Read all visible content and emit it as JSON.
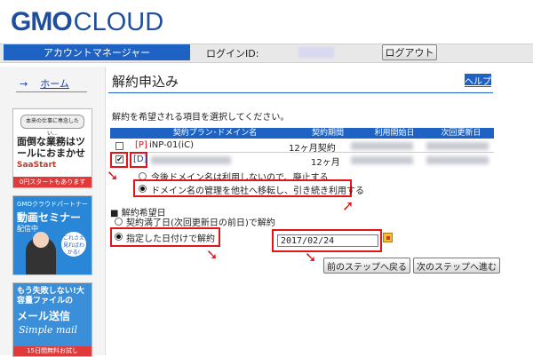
{
  "header": {
    "logo_gmo": "GMO",
    "logo_cloud": "CLOUD",
    "account_manager": "アカウントマネージャー",
    "login_label": "ログインID:",
    "logout": "ログアウト"
  },
  "sidebar": {
    "home_arrow": "→",
    "home_label": "ホーム",
    "ad1": {
      "tagline": "本来の仕事に専念したい…",
      "headline": "面倒な業務はツールにおまかせ",
      "brand": "SaaStart",
      "banner": "0円スタートもあります"
    },
    "ad2": {
      "tagline": "GMOクラウドパートナー",
      "headline": "動画セミナー",
      "sub": "配信中",
      "bubble": "これさえ見ればわかる!"
    },
    "ad3": {
      "tagline": "もう失敗しない!大容量ファイルの",
      "headline": "メール送信",
      "brand": "Simple mail",
      "banner": "15日間無料お試し"
    }
  },
  "main": {
    "title": "解約申込み",
    "help": "ヘルプ",
    "instruction": "解約を希望される項目を選択してください。",
    "table": {
      "headers": [
        "契約プラン･ドメイン名",
        "契約期間",
        "利用開始日",
        "次回更新日"
      ],
      "rows": [
        {
          "tag": "[P]",
          "name": "iNP-01(iC)",
          "period": "12ヶ月契約",
          "checked": false
        },
        {
          "tag": "[D]",
          "name": "",
          "period": "12ヶ月",
          "checked": true
        }
      ]
    },
    "domain_options": [
      {
        "label": "今後ドメイン名は利用しないので、廃止する",
        "selected": false
      },
      {
        "label": "ドメイン名の管理を他社へ移転し、引き続き利用する",
        "selected": true
      }
    ],
    "cancel_date_heading": "■ 解約希望日",
    "date_options": [
      {
        "label": "契約満了日(次回更新日の前日)で解約",
        "selected": false
      },
      {
        "label": "指定した日付けで解約",
        "selected": true
      }
    ],
    "date_value": "2017/02/24",
    "prev_button": "前のステップへ戻る",
    "next_button": "次のステップへ進む"
  },
  "colors": {
    "brand_blue": "#1e63c4",
    "highlight_red": "#e2151b",
    "logo_blue": "#1f4e9c"
  }
}
